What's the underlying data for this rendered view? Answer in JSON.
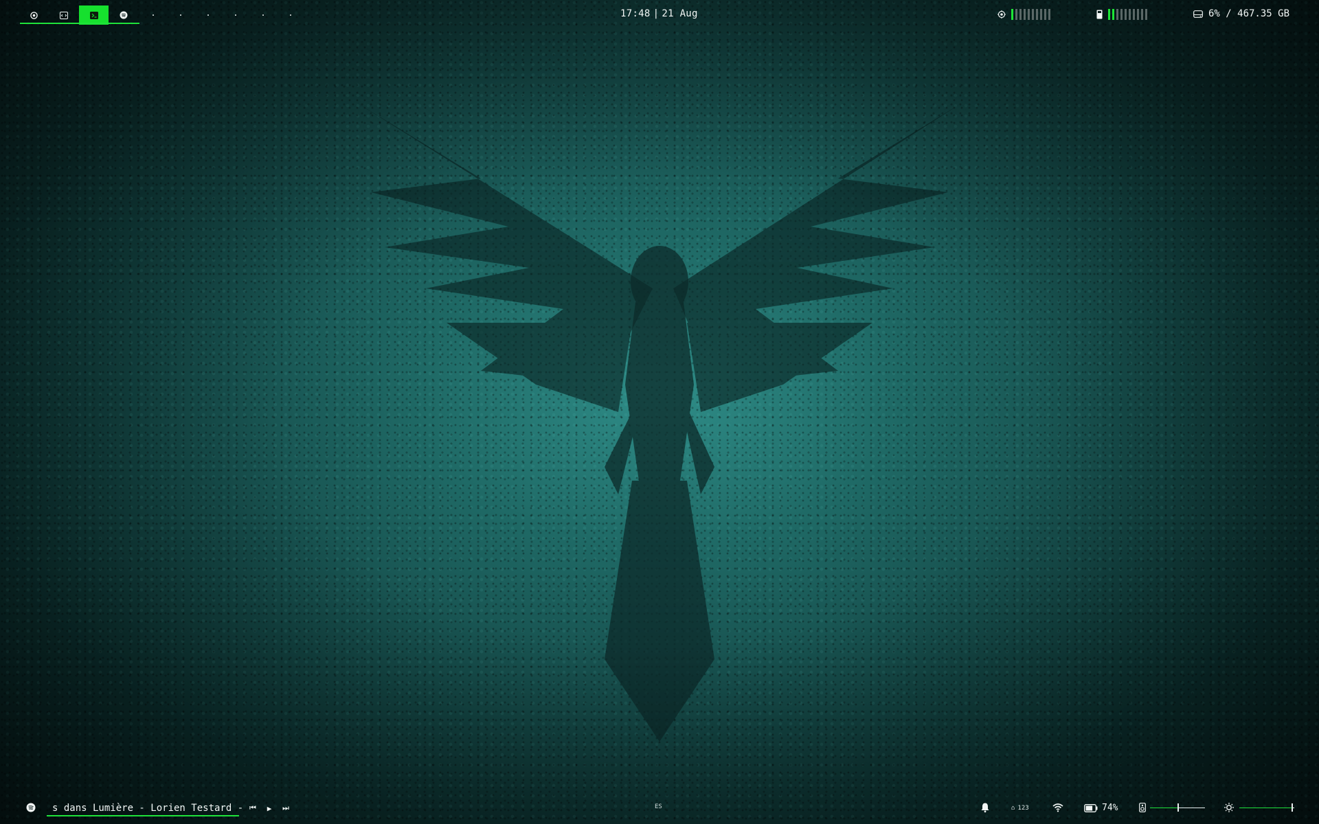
{
  "desktop": {
    "wallpaper": "teal stained-glass mosaic with winged figure"
  },
  "topbar": {
    "workspaces": [
      {
        "icon": "chrome-icon",
        "active": false
      },
      {
        "icon": "code-icon",
        "active": false
      },
      {
        "icon": "terminal-icon",
        "active": true
      },
      {
        "icon": "spotify-icon",
        "active": false
      },
      {
        "icon": "empty-dot",
        "active": false
      },
      {
        "icon": "empty-dot",
        "active": false
      },
      {
        "icon": "empty-dot",
        "active": false
      },
      {
        "icon": "empty-dot",
        "active": false
      },
      {
        "icon": "empty-dot",
        "active": false
      },
      {
        "icon": "empty-dot",
        "active": false
      }
    ],
    "time": "17:48",
    "separator": "|",
    "date": "21 Aug",
    "cpu": {
      "icon": "cpu-icon",
      "bars_on": 1,
      "bars_total": 10
    },
    "ram": {
      "icon": "memory-icon",
      "bars_on": 2,
      "bars_total": 10
    },
    "disk": {
      "icon": "disk-icon",
      "text": "6% / 467.35 GB"
    }
  },
  "bottombar": {
    "player": {
      "icon": "spotify-icon",
      "track": "s dans Lumière - Lorien Testard -",
      "prev": "⏮",
      "play": "▶",
      "next": "⏭"
    },
    "keyboard_layout": "ES",
    "notifications": {
      "icon": "bell-icon"
    },
    "lock_keys": {
      "caps": "⌂",
      "num": "123"
    },
    "wifi": {
      "icon": "wifi-icon"
    },
    "battery": {
      "icon": "battery-icon",
      "text": "74%",
      "level": 0.74
    },
    "volume": {
      "icon": "speaker-icon",
      "level": 0.5
    },
    "brightness": {
      "icon": "brightness-icon",
      "level": 0.95
    },
    "colors": {
      "accent": "#1ee23a",
      "muted": "#5a6867",
      "text": "#f2f6f5"
    }
  }
}
